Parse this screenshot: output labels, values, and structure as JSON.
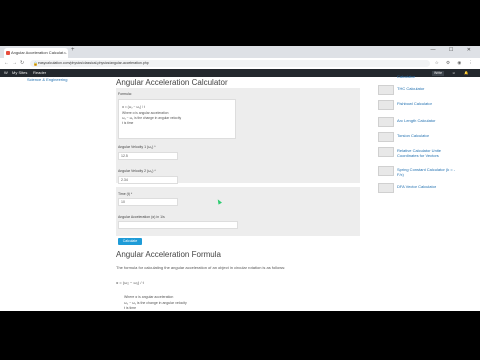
{
  "browser": {
    "tab_title": "Angular Acceleration Calculat…",
    "tab_close": "×",
    "new_tab": "+",
    "window_controls": "— ☐ ✕",
    "url": "easycalculation.com/physics/classical-physics/angular-acceleration.php",
    "back": "←",
    "forward": "→",
    "reload": "↻",
    "ext_icons": "☆ ⚙ ◉ ⋮"
  },
  "wpbar": {
    "logo": "W",
    "my_sites": "My Sites",
    "reader": "Reader",
    "right_items": [
      "Write",
      "☺",
      "🔔"
    ]
  },
  "left_sidebar": {
    "category": "Science & Engineering"
  },
  "calculator": {
    "title": "Angular Acceleration Calculator",
    "formula_label": "Formula:",
    "formula_lines": [
      "α = (ω₂ − ω₁) / t",
      "Where α is angular acceleration",
      "ω₂ − ω₁ is the change in angular velocity",
      "t is time"
    ],
    "fields": [
      {
        "label": "Angular Velocity 1 (ω₁) *",
        "value": "12.5"
      },
      {
        "label": "Angular Velocity 2 (ω₂) *",
        "value": "2.34"
      },
      {
        "label": "Time (t) *",
        "value": "10"
      },
      {
        "label": "Angular Acceleration (α) in 1/s",
        "value": ""
      }
    ],
    "button": "Calculate"
  },
  "article": {
    "heading": "Angular Acceleration Formula",
    "intro": "The formula for calculating the angular acceleration of an object in circular rotation is as follows:",
    "formula": "α = (ω₂ − ω₁) / t",
    "bullets": [
      "Where α is angular acceleration",
      "ω₂ − ω₁ is the change in angular velocity",
      "t is time"
    ]
  },
  "related": [
    "Calculator",
    "THC Calculator",
    "Fishbowl Calculator",
    "Arc Length Calculator",
    "Torsion Calculator",
    "Relative Calculator Unite Coordinates for Vectors",
    "Spring Constant Calculator (k = -F/x)",
    "DFA Vector Calculator"
  ]
}
